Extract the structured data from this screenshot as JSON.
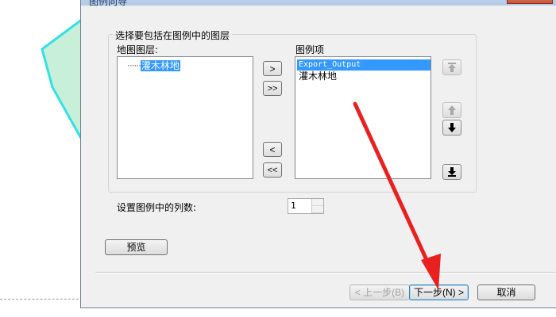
{
  "dialog": {
    "title": "图例向导",
    "layer_group_title": "选择要包括在图例中的图层",
    "map_layers_label": "地图图层:",
    "legend_items_label": "图例项",
    "map_layers": [
      "灌木林地"
    ],
    "legend_items": [
      "Export_Output",
      "灌木林地"
    ],
    "columns_label": "设置图例中的列数:",
    "columns_value": "1",
    "preview_label": "预览",
    "back_label": "< 上一步(B)",
    "next_label": "下一步(N) >",
    "cancel_label": "取消"
  },
  "move_buttons": {
    "add_one": ">",
    "add_all": ">>",
    "remove_one": "<",
    "remove_all": "<<"
  },
  "icons": [
    "move-top-icon",
    "move-up-icon",
    "move-down-icon",
    "move-bottom-icon"
  ],
  "colors": {
    "selection": "#3399ff",
    "annotation_arrow": "#e82020",
    "polygon_fill": "#c8f0d8",
    "polygon_stroke": "#33e0e8"
  }
}
